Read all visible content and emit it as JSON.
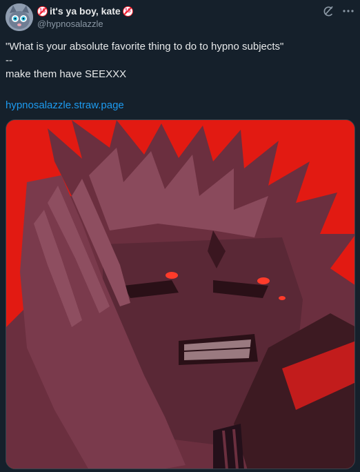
{
  "author": {
    "display_name": "it's ya boy, kate",
    "handle": "@hypnosalazzle",
    "badge_left": "18",
    "badge_right": "18"
  },
  "tweet": {
    "line1": "\"What is your absolute favorite thing to do to hypno subjects\"",
    "line2": "--",
    "line3": "make them have SEEXXX",
    "link": "hypnosalazzle.straw.page"
  },
  "icons": {
    "grok": "grok-icon",
    "more": "more-dots-icon",
    "badge": "no-under-18-icon"
  },
  "colors": {
    "background": "#15202b",
    "text": "#e7e9ea",
    "secondary": "#8b98a5",
    "link": "#1d9bf0",
    "media_red": "#e21a12"
  },
  "media": {
    "alt": "Illustration of a fierce spiky-haired character with red eyes and clasped hands against a red background"
  }
}
